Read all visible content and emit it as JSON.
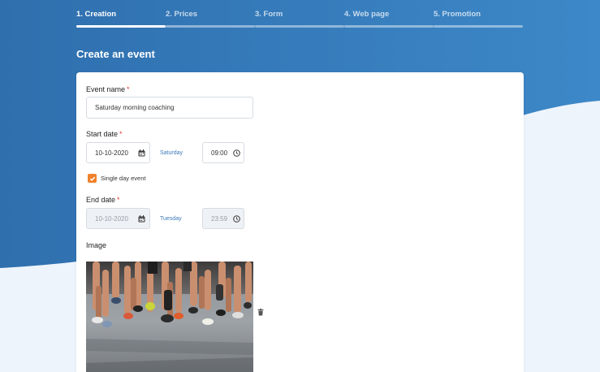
{
  "stepper": {
    "steps": [
      {
        "label": "1. Creation",
        "active": true
      },
      {
        "label": "2. Prices",
        "active": false
      },
      {
        "label": "3. Form",
        "active": false
      },
      {
        "label": "4. Web page",
        "active": false
      },
      {
        "label": "5. Promotion",
        "active": false
      }
    ]
  },
  "page": {
    "title": "Create an event"
  },
  "form": {
    "event_name": {
      "label": "Event name",
      "required_mark": "*",
      "value": "Saturday morning coaching"
    },
    "start_date": {
      "label": "Start date",
      "required_mark": "*",
      "date": "10-10-2020",
      "weekday": "Saturday",
      "time": "09:00"
    },
    "single_day": {
      "label": "Single day event",
      "checked": true
    },
    "end_date": {
      "label": "End date",
      "required_mark": "*",
      "date": "10-10-2020",
      "weekday": "Tuesday",
      "time": "23:59"
    },
    "image": {
      "label": "Image"
    }
  },
  "colors": {
    "primary_blue": "#3679b9",
    "background": "#eef4fb",
    "checkbox_orange": "#f0812b",
    "required_red": "#e53935",
    "weekday_blue": "#3a79b7"
  },
  "icons": [
    "calendar-icon",
    "clock-icon",
    "check-icon",
    "trash-icon"
  ]
}
